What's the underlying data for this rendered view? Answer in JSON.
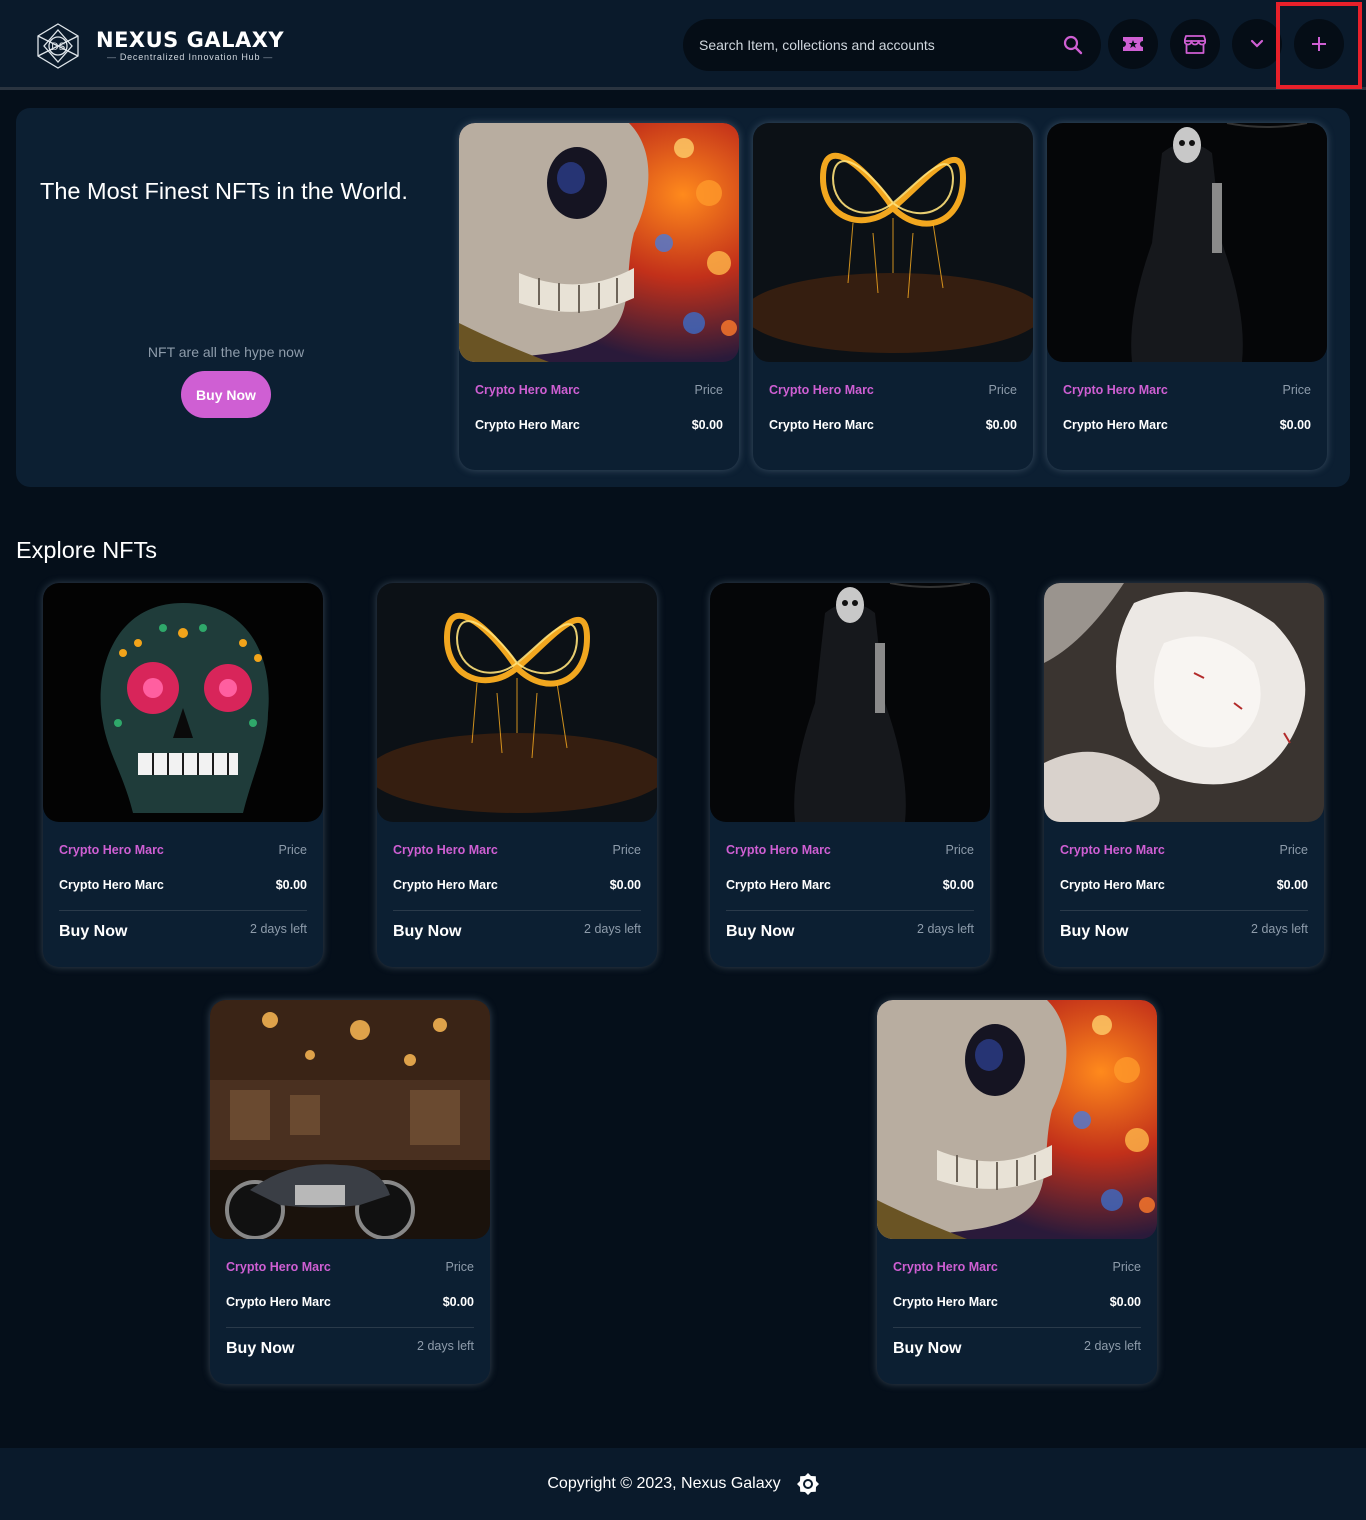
{
  "header": {
    "brand_name": "NEXUS GALAXY",
    "brand_tagline": "Decentralized Innovation Hub",
    "search_placeholder": "Search Item, collections and accounts",
    "buttons": [
      "ticket-icon",
      "store-icon",
      "chevron-down-icon",
      "plus-icon"
    ]
  },
  "colors": {
    "accent": "#cf5fd3",
    "background": "#050f1a",
    "surface": "#0c1f32",
    "highlight": "#e8202a"
  },
  "hero": {
    "title": "The Most Finest NFTs in the World.",
    "subtitle": "NFT are all the hype now",
    "buy_label": "Buy Now",
    "cards": [
      {
        "image": "skull-bokeh",
        "creator": "Crypto Hero Marc",
        "price_label": "Price",
        "name": "Crypto Hero Marc",
        "price": "$0.00"
      },
      {
        "image": "fire-infinity",
        "creator": "Crypto Hero Marc",
        "price_label": "Price",
        "name": "Crypto Hero Marc",
        "price": "$0.00"
      },
      {
        "image": "dark-figure",
        "creator": "Crypto Hero Marc",
        "price_label": "Price",
        "name": "Crypto Hero Marc",
        "price": "$0.00"
      }
    ]
  },
  "explore": {
    "title": "Explore NFTs",
    "cards": [
      {
        "image": "sugar-skull",
        "creator": "Crypto Hero Marc",
        "price_label": "Price",
        "name": "Crypto Hero Marc",
        "price": "$0.00",
        "buy_label": "Buy Now",
        "time_left": "2 days left"
      },
      {
        "image": "fire-infinity",
        "creator": "Crypto Hero Marc",
        "price_label": "Price",
        "name": "Crypto Hero Marc",
        "price": "$0.00",
        "buy_label": "Buy Now",
        "time_left": "2 days left"
      },
      {
        "image": "dark-figure",
        "creator": "Crypto Hero Marc",
        "price_label": "Price",
        "name": "Crypto Hero Marc",
        "price": "$0.00",
        "buy_label": "Buy Now",
        "time_left": "2 days left"
      },
      {
        "image": "white-flowers",
        "creator": "Crypto Hero Marc",
        "price_label": "Price",
        "name": "Crypto Hero Marc",
        "price": "$0.00",
        "buy_label": "Buy Now",
        "time_left": "2 days left"
      },
      {
        "image": "motorcycle-shop",
        "creator": "Crypto Hero Marc",
        "price_label": "Price",
        "name": "Crypto Hero Marc",
        "price": "$0.00",
        "buy_label": "Buy Now",
        "time_left": "2 days left"
      },
      {
        "image": "skull-bokeh",
        "creator": "Crypto Hero Marc",
        "price_label": "Price",
        "name": "Crypto Hero Marc",
        "price": "$0.00",
        "buy_label": "Buy Now",
        "time_left": "2 days left"
      }
    ]
  },
  "footer": {
    "copyright": "Copyright © 2023, Nexus Galaxy",
    "theme_icon": "sun-icon"
  }
}
